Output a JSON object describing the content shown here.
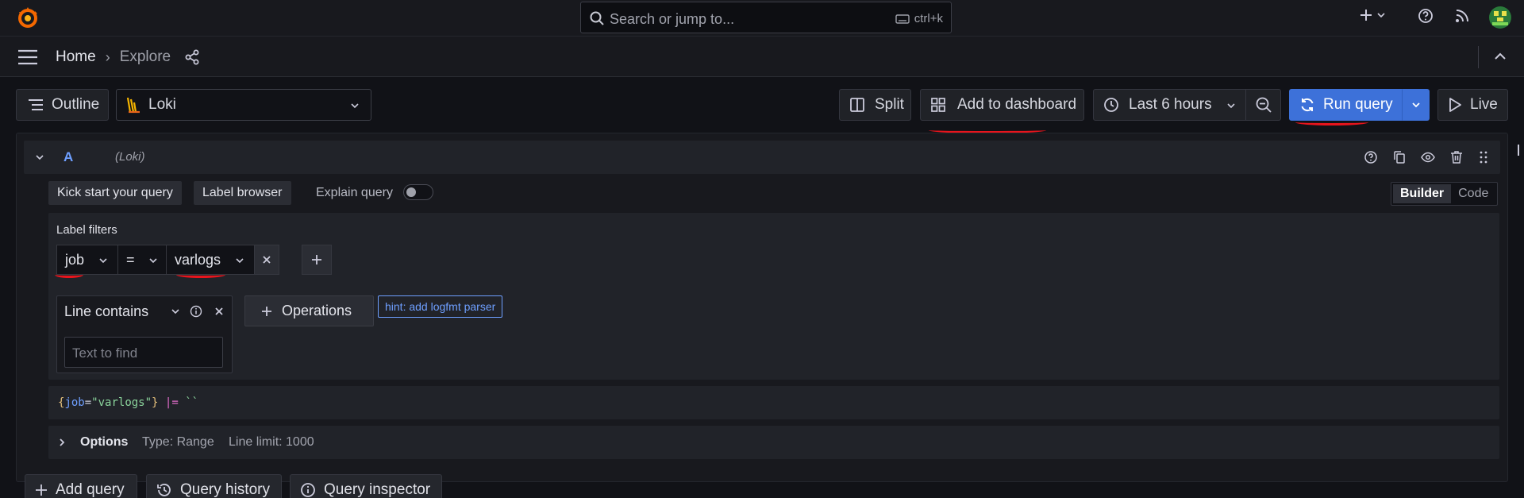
{
  "topbar": {
    "search_placeholder": "Search or jump to...",
    "search_shortcut": "ctrl+k"
  },
  "breadcrumb": {
    "home": "Home",
    "separator": "›",
    "current": "Explore"
  },
  "toolbar": {
    "outline_label": "Outline",
    "datasource": "Loki",
    "split_label": "Split",
    "add_dashboard_label": "Add to dashboard",
    "time_range": "Last 6 hours",
    "run_query_label": "Run query",
    "live_label": "Live"
  },
  "query": {
    "ref_id": "A",
    "datasource_hint": "(Loki)",
    "kick_start_label": "Kick start your query",
    "label_browser_label": "Label browser",
    "explain_label": "Explain query",
    "mode_builder": "Builder",
    "mode_code": "Code",
    "label_filters_title": "Label filters",
    "filter": {
      "label": "job",
      "operator": "=",
      "value": "varlogs"
    },
    "line_contains_label": "Line contains",
    "text_placeholder": "Text to find",
    "operations_label": "Operations",
    "hint_label": "hint: add logfmt parser",
    "code": {
      "open_brace": "{",
      "key": "job",
      "eq": "=",
      "value": "\"varlogs\"",
      "close_brace": "}",
      "pipe": "|=",
      "string": "``"
    },
    "options_label": "Options",
    "type_text": "Type: Range",
    "line_limit_text": "Line limit: 1000"
  },
  "bottom": {
    "add_query_label": "Add query",
    "history_label": "Query history",
    "inspector_label": "Query inspector"
  },
  "colors": {
    "background": "#111217",
    "panel": "#18191e",
    "primary": "#3d71d9",
    "annotation_red": "#e8141c",
    "hint_blue": "#6e9fff"
  }
}
